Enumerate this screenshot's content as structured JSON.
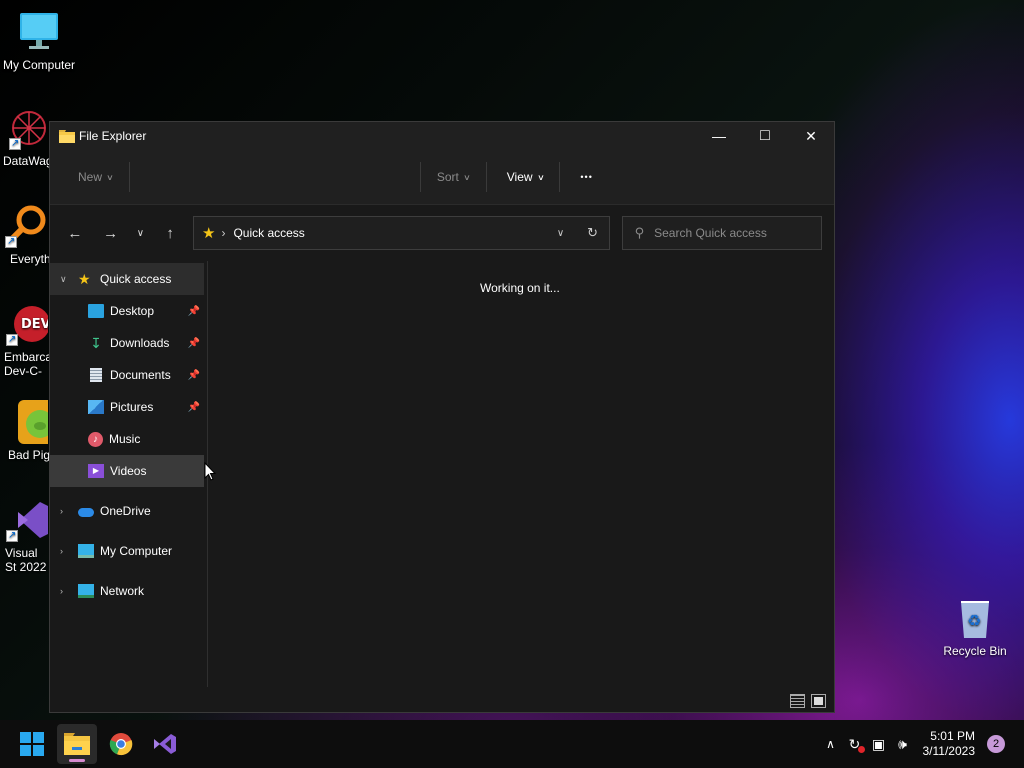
{
  "desktop": {
    "icons": [
      {
        "label": "My Computer",
        "icon": "monitor-icon"
      },
      {
        "label": "DataWag",
        "icon": "datawag-icon"
      },
      {
        "label": "Everyth",
        "icon": "everything-icon"
      },
      {
        "label": "Embarca Dev-C-",
        "icon": "devcpp-icon"
      },
      {
        "label": "Bad Pig",
        "icon": "badpiggies-icon"
      },
      {
        "label": "Visual St 2022",
        "icon": "visualstudio-icon"
      },
      {
        "label": "Recycle Bin",
        "icon": "recycle-bin-icon"
      }
    ]
  },
  "window": {
    "title": "File Explorer",
    "controls": {
      "minimize": "—",
      "maximize": "□",
      "close": "✕"
    }
  },
  "cmdbar": {
    "new_label": "New",
    "sort_label": "Sort",
    "view_label": "View",
    "more_label": "•••"
  },
  "address": {
    "location": "Quick access",
    "search_placeholder": "Search Quick access"
  },
  "nav": {
    "quick_access": "Quick access",
    "quick_items": [
      {
        "label": "Desktop",
        "pinned": true
      },
      {
        "label": "Downloads",
        "pinned": true
      },
      {
        "label": "Documents",
        "pinned": true
      },
      {
        "label": "Pictures",
        "pinned": true
      },
      {
        "label": "Music",
        "pinned": false
      },
      {
        "label": "Videos",
        "pinned": false
      }
    ],
    "onedrive": "OneDrive",
    "my_computer": "My Computer",
    "network": "Network"
  },
  "content": {
    "status": "Working on it..."
  },
  "taskbar": {
    "time": "5:01 PM",
    "date": "3/11/2023",
    "notifications": "2"
  },
  "colors": {
    "accent_star": "#f5c518",
    "window_bg": "#191919",
    "notif_badge": "#c79ad9"
  }
}
